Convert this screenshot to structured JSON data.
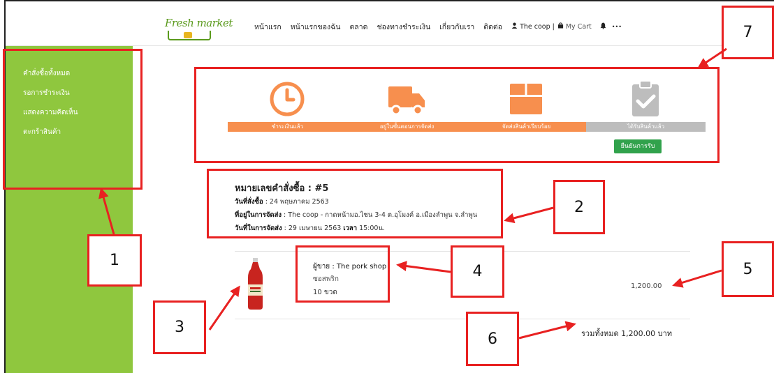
{
  "header": {
    "logo_text": "Fresh market",
    "nav": [
      {
        "label": "หน้าแรก"
      },
      {
        "label": "หน้าแรกของฉัน"
      },
      {
        "label": "ตลาด"
      },
      {
        "label": "ช่องทางชำระเงิน"
      },
      {
        "label": "เกี่ยวกับเรา"
      },
      {
        "label": "ติดต่อ"
      }
    ],
    "user_label": "The coop |",
    "cart_label": "My Cart",
    "more_label": "•••"
  },
  "sidebar": {
    "items": [
      {
        "label": "คำสั่งซื้อทั้งหมด"
      },
      {
        "label": "รอการชำระเงิน"
      },
      {
        "label": "แสดงความคิดเห็น"
      },
      {
        "label": "ตะกร้าสินค้า"
      }
    ]
  },
  "steps": [
    {
      "label": "ชำระเงินแล้ว",
      "icon": "clock-icon",
      "active": true
    },
    {
      "label": "อยู่ในขั้นตอนการจัดส่ง",
      "icon": "truck-icon",
      "active": true
    },
    {
      "label": "จัดส่งสินค้าเรียบร้อย",
      "icon": "package-icon",
      "active": true
    },
    {
      "label": "ได้รับสินค้าแล้ว",
      "icon": "clipboard-check-icon",
      "active": false
    }
  ],
  "confirm_button": "ยืนยันการรับ",
  "order": {
    "number_label": "หมายเลขคำสั่งซื้อ : #5",
    "date_key": "วันที่สั่งซื้อ",
    "date_value": " : 24 พฤษภาคม 2563",
    "address_key": "ที่อยู่ในการจัดส่ง",
    "address_value": " : The coop - กาดหน้ามอ.ไชน 3-4 ต.อุโมงค์ อ.เมืองลำพูน จ.ลำพูน",
    "delivery_key": "วันที่ในการจัดส่ง",
    "delivery_value": " : 29 เมษายน 2563 ",
    "time_key": "เวลา",
    "time_value": " 15:00น."
  },
  "item": {
    "seller": "ผู้ขาย : The pork shop",
    "name": "ซอสพริก",
    "qty": "10 ขวด",
    "price": "1,200.00"
  },
  "total": "รวมทั้งหมด 1,200.00 บาท",
  "annotations": [
    "1",
    "2",
    "3",
    "4",
    "5",
    "6",
    "7"
  ],
  "colors": {
    "sidebar": "#8fc73e",
    "step_active": "#f78f4e",
    "step_inactive": "#bdbdbd",
    "confirm": "#31a24c",
    "annotation": "#e82121"
  }
}
